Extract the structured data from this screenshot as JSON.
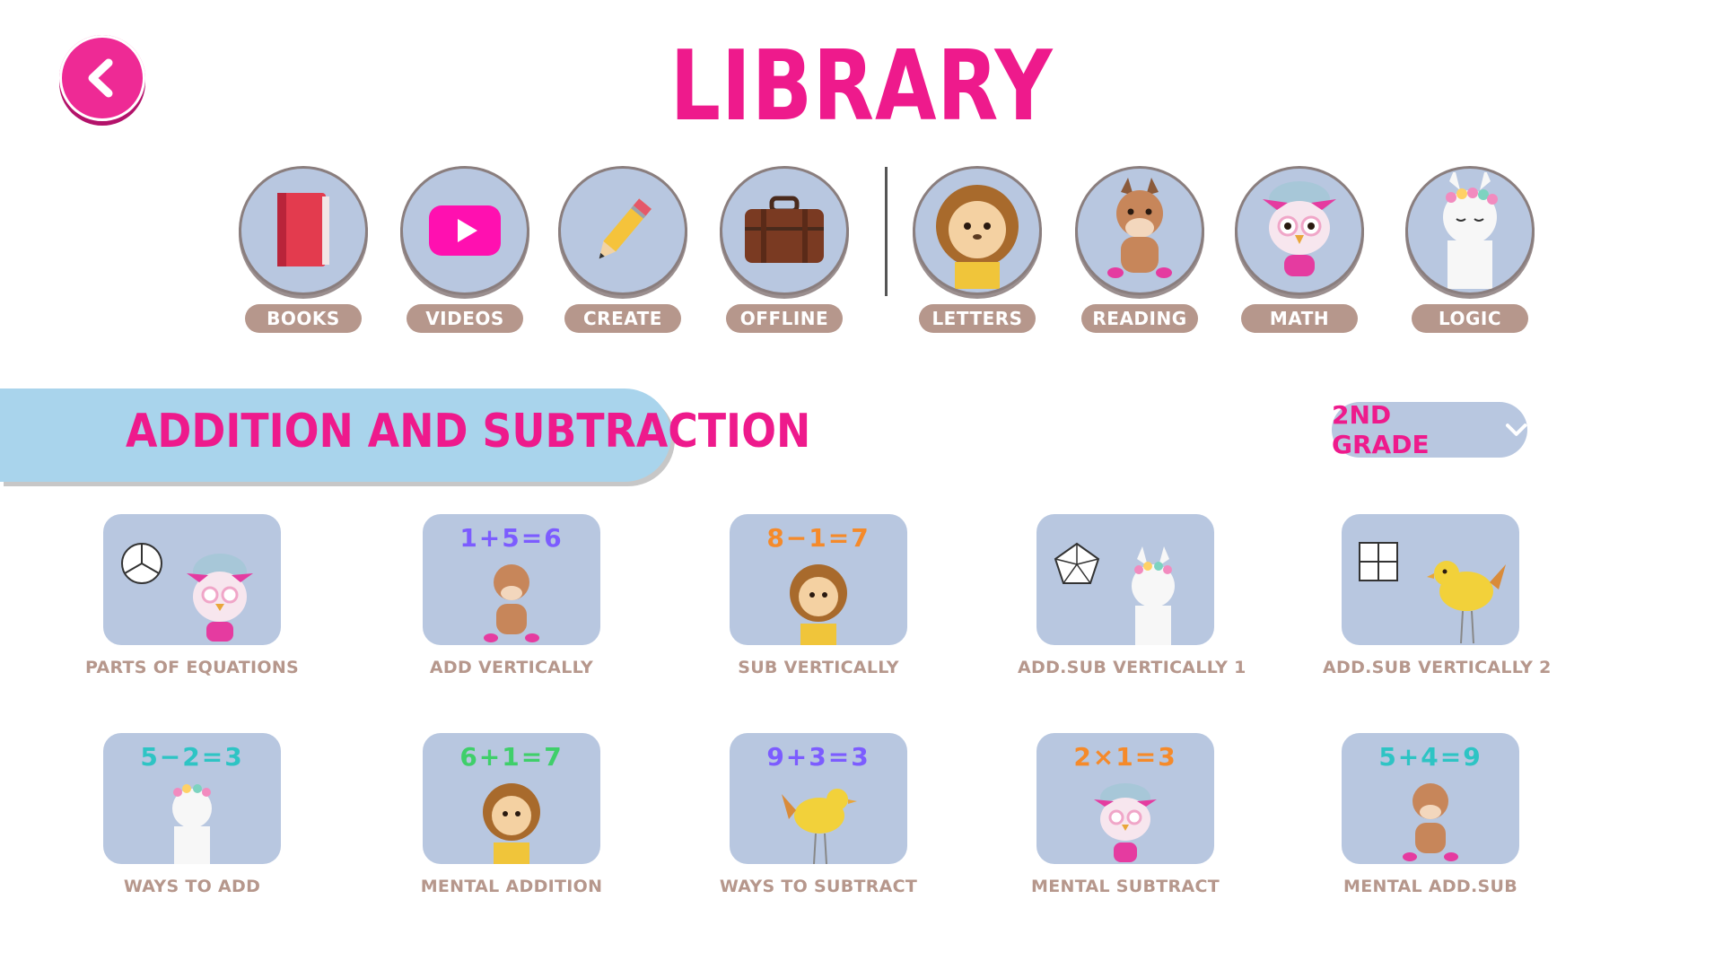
{
  "title": "LIBRARY",
  "categories": [
    {
      "label": "BOOKS",
      "icon": "book-icon"
    },
    {
      "label": "VIDEOS",
      "icon": "video-play-icon"
    },
    {
      "label": "CREATE",
      "icon": "pencil-icon"
    },
    {
      "label": "OFFLINE",
      "icon": "suitcase-icon"
    },
    {
      "label": "LETTERS",
      "icon": "lion-icon"
    },
    {
      "label": "READING",
      "icon": "horse-icon"
    },
    {
      "label": "MATH",
      "icon": "owl-icon"
    },
    {
      "label": "LOGIC",
      "icon": "llama-icon"
    }
  ],
  "section": {
    "title": "ADDITION AND SUBTRACTION"
  },
  "grade": {
    "selected": "2ND GRADE"
  },
  "lessons": [
    {
      "label": "PARTS OF EQUATIONS",
      "equation": "",
      "shape": "circle-thirds",
      "animal": "owl"
    },
    {
      "label": "ADD VERTICALLY",
      "equation": "1+5=6",
      "animal": "horse"
    },
    {
      "label": "SUB VERTICALLY",
      "equation": "8−1=7",
      "animal": "lion"
    },
    {
      "label": "ADD.SUB VERTICALLY 1",
      "equation": "",
      "shape": "pentagon",
      "animal": "llama"
    },
    {
      "label": "ADD.SUB VERTICALLY 2",
      "equation": "",
      "shape": "square-quarters",
      "animal": "bird"
    },
    {
      "label": "WAYS TO ADD",
      "equation": "5−2=3",
      "animal": "llama"
    },
    {
      "label": "MENTAL ADDITION",
      "equation": "6+1=7",
      "animal": "lion"
    },
    {
      "label": "WAYS TO SUBTRACT",
      "equation": "9+3=3",
      "animal": "bird"
    },
    {
      "label": "MENTAL SUBTRACT",
      "equation": "2×1=3",
      "animal": "owl"
    },
    {
      "label": "MENTAL ADD.SUB",
      "equation": "5+4=9",
      "animal": "horse"
    }
  ],
  "colors": {
    "accent": "#ee1a8c",
    "tile_bg": "#b8c7e0",
    "label_brown": "#b6978c",
    "banner_blue": "#a9d4ec"
  }
}
